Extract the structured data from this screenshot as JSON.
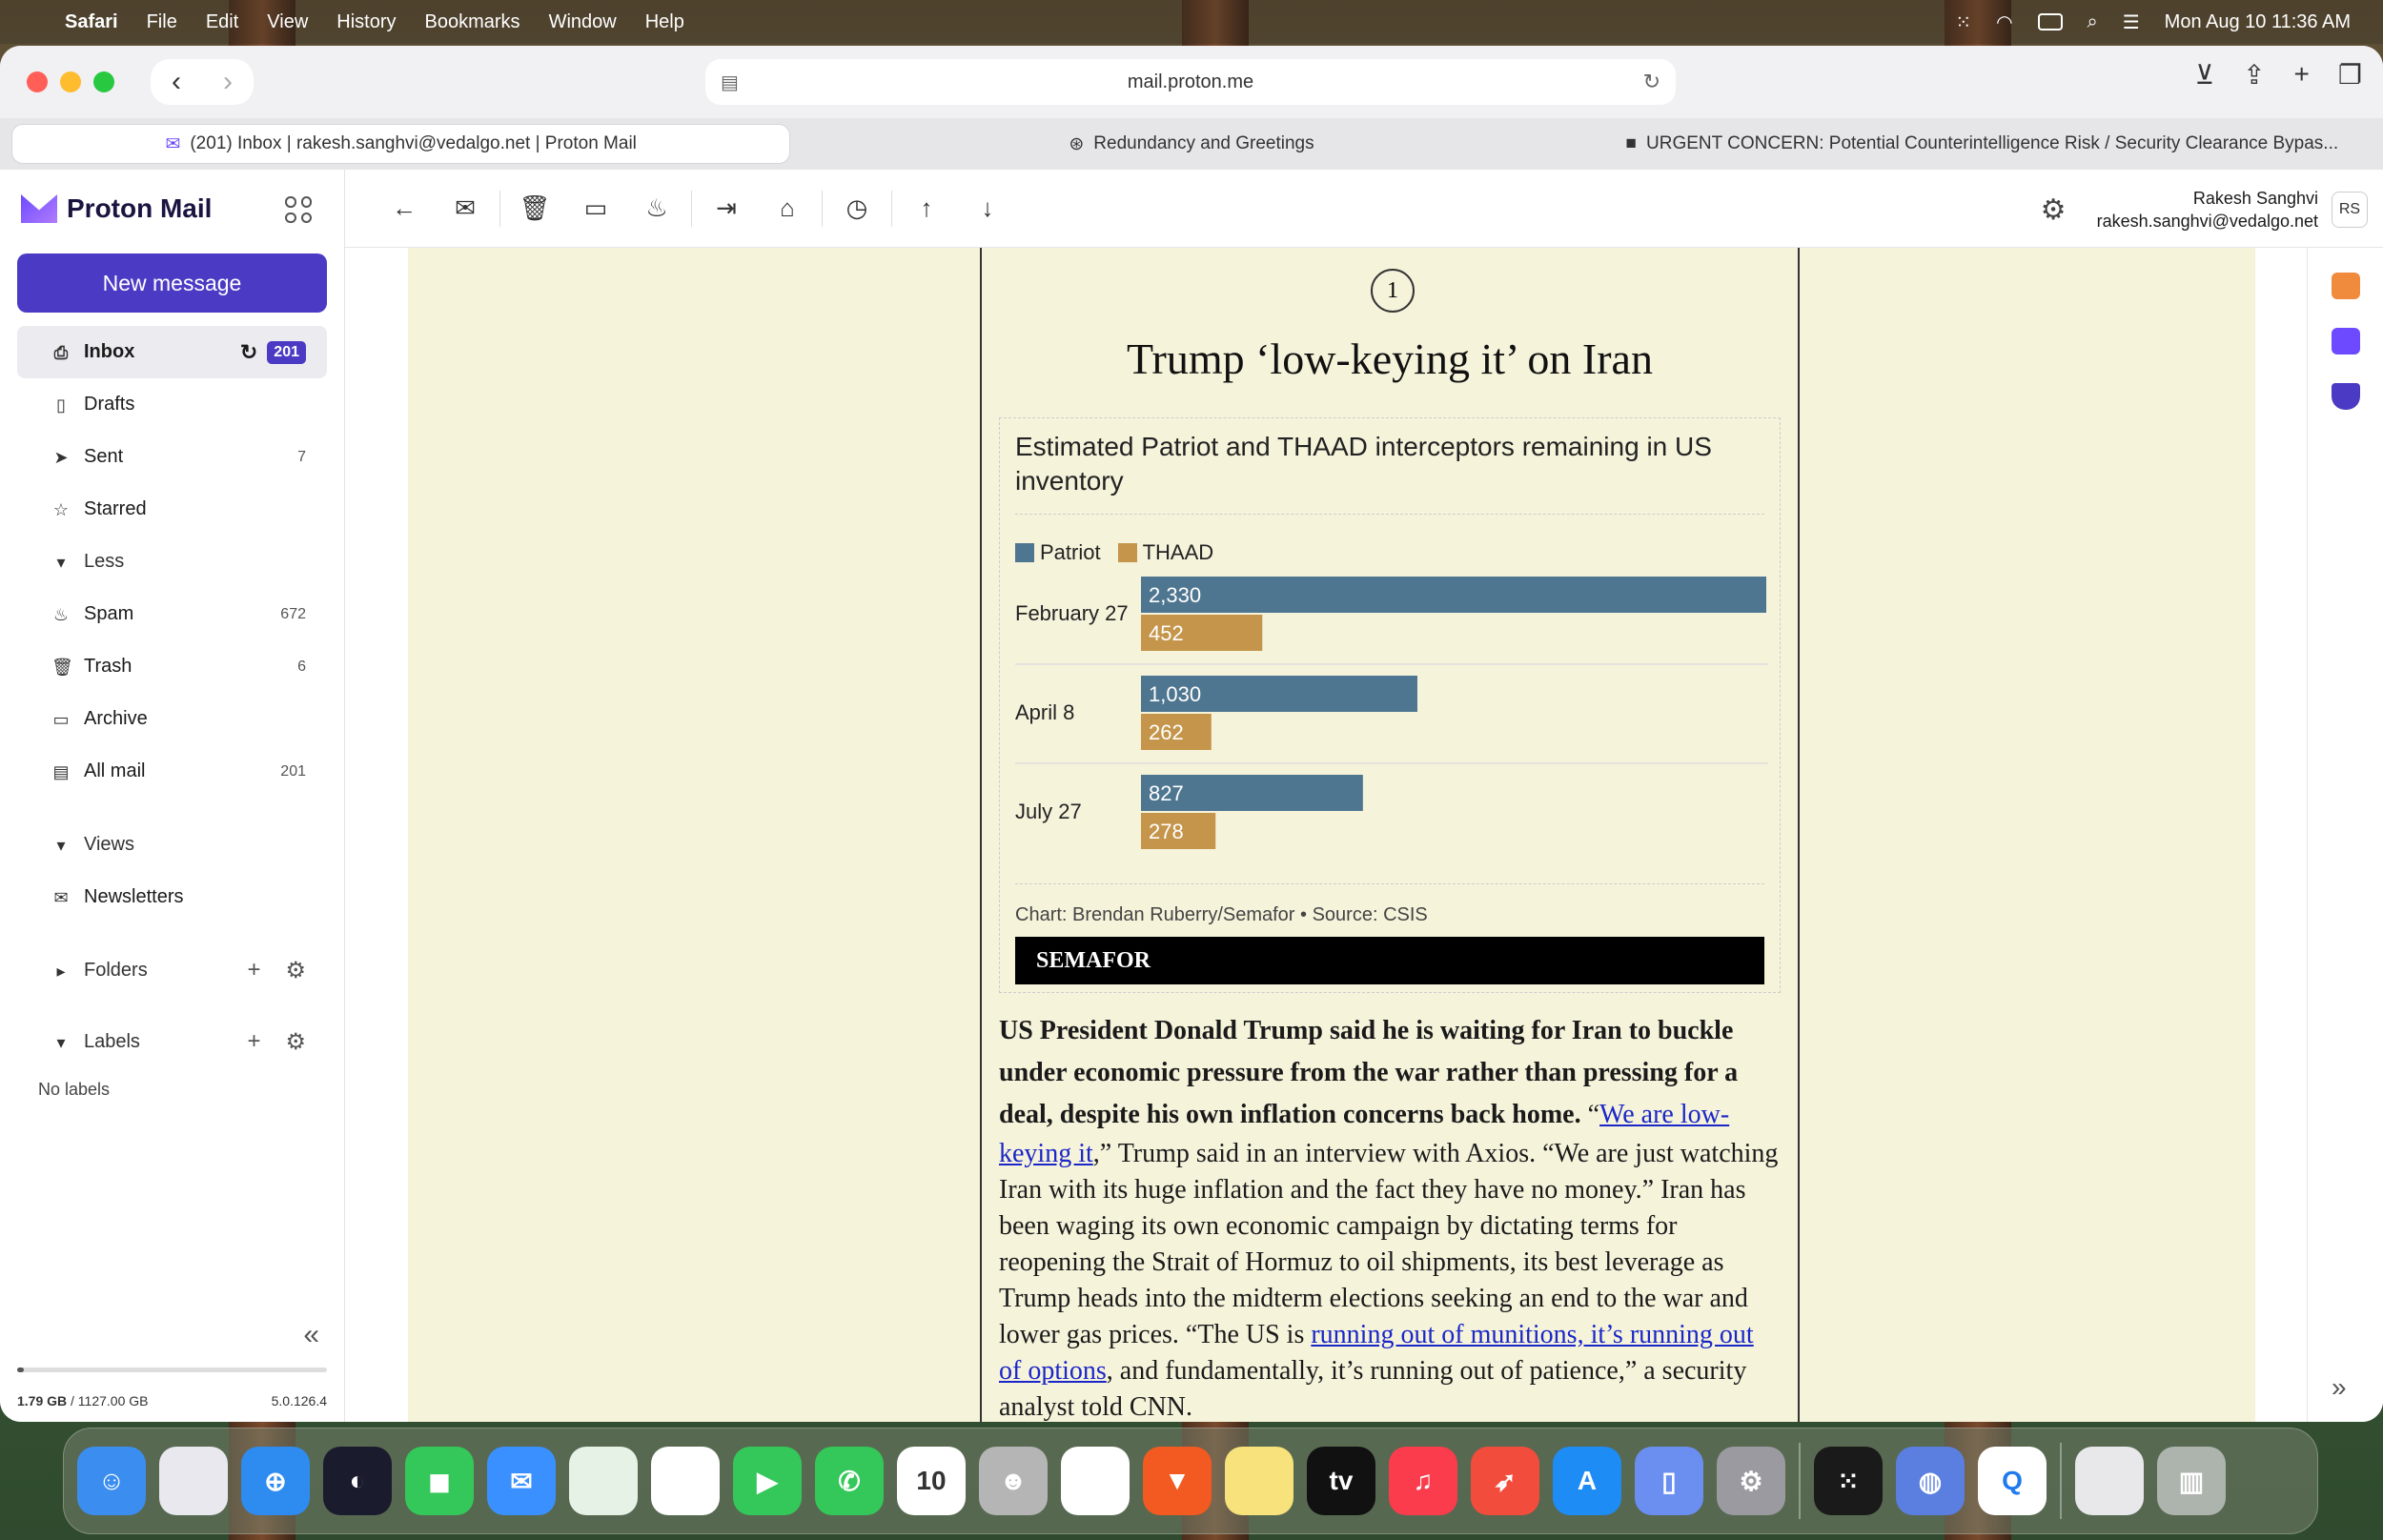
{
  "menubar": {
    "app": "Safari",
    "menus": [
      "File",
      "Edit",
      "View",
      "History",
      "Bookmarks",
      "Window",
      "Help"
    ],
    "datetime": "Mon Aug 10  11:36 AM"
  },
  "browser": {
    "url": "mail.proton.me",
    "tabs": [
      {
        "title": "(201) Inbox | rakesh.sanghvi@vedalgo.net | Proton Mail",
        "active": true
      },
      {
        "title": "Redundancy and Greetings",
        "active": false
      },
      {
        "title": "URGENT CONCERN: Potential Counterintelligence Risk / Security Clearance Bypas...",
        "active": false
      }
    ]
  },
  "app": {
    "logo": "Proton Mail",
    "new_message": "New message"
  },
  "folders": [
    {
      "label": "Inbox",
      "count": "201",
      "icon": "inbox-icon"
    },
    {
      "label": "Drafts",
      "count": "",
      "icon": "drafts-icon"
    },
    {
      "label": "Sent",
      "count": "7",
      "icon": "sent-icon"
    },
    {
      "label": "Starred",
      "count": "",
      "icon": "star-icon"
    },
    {
      "label": "Less",
      "count": "",
      "icon": "chevron-down-icon"
    },
    {
      "label": "Spam",
      "count": "672",
      "icon": "spam-icon"
    },
    {
      "label": "Trash",
      "count": "6",
      "icon": "trash-icon"
    },
    {
      "label": "Archive",
      "count": "",
      "icon": "archive-icon"
    },
    {
      "label": "All mail",
      "count": "201",
      "icon": "all-mail-icon"
    }
  ],
  "sections": {
    "views": "Views",
    "newsletters": "Newsletters",
    "folders": "Folders",
    "labels": "Labels",
    "no_labels": "No labels"
  },
  "storage": {
    "used": "1.79 GB",
    "total": "/ 1127.00 GB",
    "version": "5.0.126.4",
    "fraction": 0.0016
  },
  "user": {
    "name": "Rakesh Sanghvi",
    "email": "rakesh.sanghvi@vedalgo.net",
    "initials": "RS"
  },
  "email": {
    "number": "1",
    "headline": "Trump ‘low-keying it’ on Iran",
    "credit": "Chart: Brendan Ruberry/Semafor • Source: CSIS",
    "brand": "SEMAFOR",
    "lead_bold": "US President Donald Trump said he is waiting for Iran to buckle under economic pressure from the war rather than pressing for a deal, despite his own inflation concerns back home.",
    "quote_open": " “",
    "link1": "We are low-keying it",
    "text1": ",” Trump said in an interview with Axios. “We are just watching Iran with its huge inflation and the fact they have no money.” Iran has been waging its own economic campaign by dictating terms for reopening the Strait of Hormuz to oil shipments, its best leverage as Trump heads into the midterm elections seeking an end to the war and lower gas prices. “The US is ",
    "link2": "running out of munitions, it’s running out of options",
    "text2": ", and fundamentally, it’s running out of patience,” a security analyst told CNN."
  },
  "colors": {
    "patriot": "#4f7690",
    "thaad": "#c4954a",
    "accent": "#4b3bc4"
  },
  "chart_data": {
    "type": "bar",
    "title": "Estimated Patriot and THAAD interceptors remaining in US inventory",
    "categories": [
      "February 27",
      "April 8",
      "July 27"
    ],
    "series": [
      {
        "name": "Patriot",
        "values": [
          2330,
          1030,
          827
        ]
      },
      {
        "name": "THAAD",
        "values": [
          452,
          262,
          278
        ]
      }
    ],
    "value_labels": [
      [
        "2,330",
        "452"
      ],
      [
        "1,030",
        "262"
      ],
      [
        "827",
        "278"
      ]
    ],
    "xlim": [
      0,
      2330
    ],
    "legend": "top-left",
    "grid": false
  }
}
